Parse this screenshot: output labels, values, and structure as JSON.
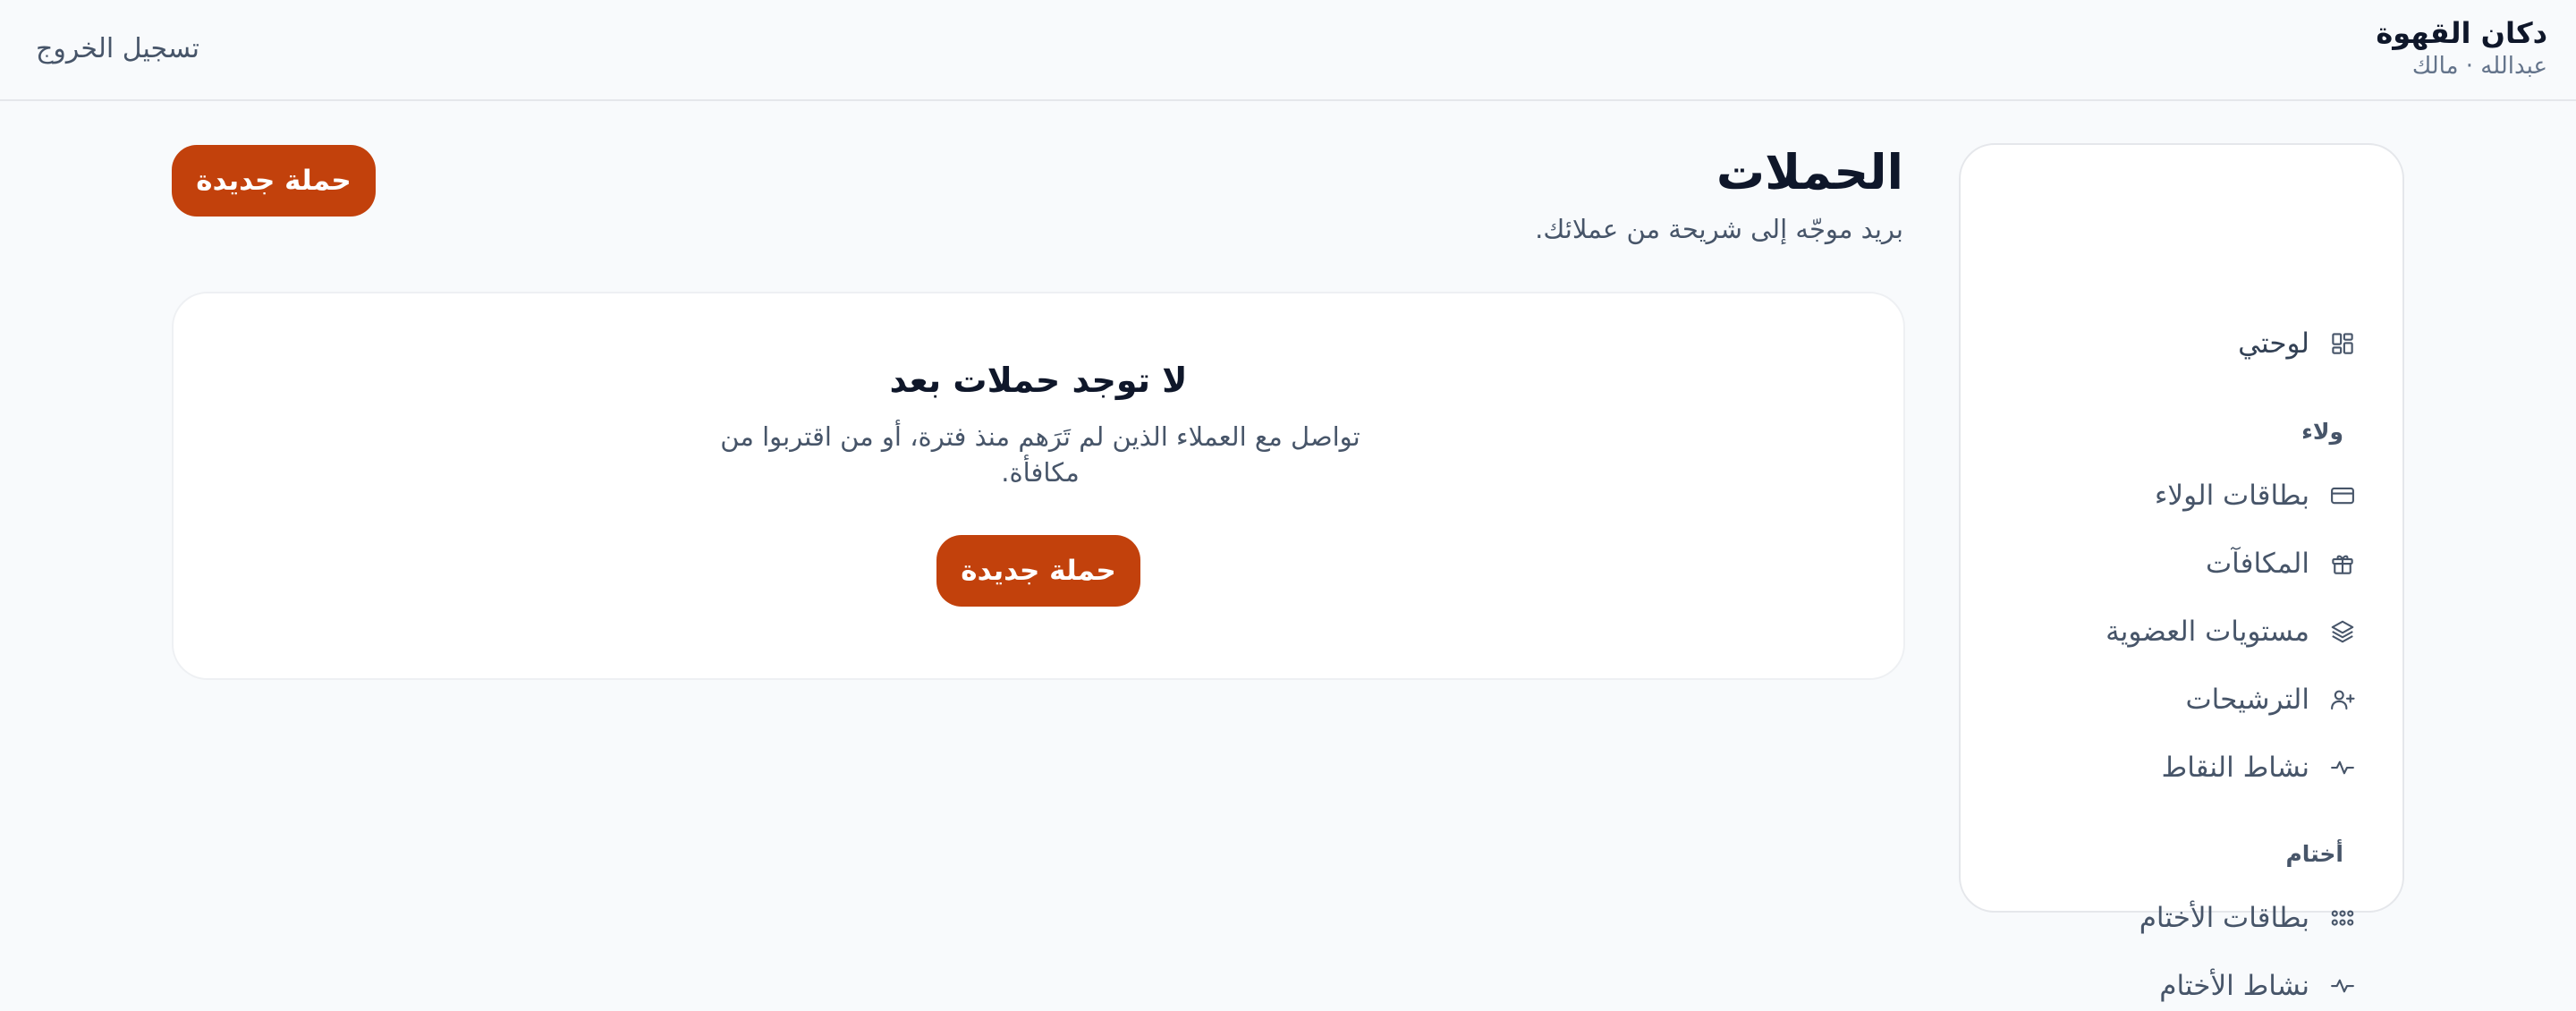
{
  "header": {
    "brand_name": "دكان القهوة",
    "user_line": "عبدالله · مالك",
    "logout_label": "تسجيل الخروج"
  },
  "sidebar": {
    "items": [
      {
        "label": "لوحتي",
        "icon": "dashboard-icon"
      }
    ],
    "sections": [
      {
        "title": "ولاء",
        "items": [
          {
            "label": "بطاقات الولاء",
            "icon": "card-icon"
          },
          {
            "label": "المكافآت",
            "icon": "gift-icon"
          },
          {
            "label": "مستويات العضوية",
            "icon": "layers-icon"
          },
          {
            "label": "الترشيحات",
            "icon": "user-plus-icon"
          },
          {
            "label": "نشاط النقاط",
            "icon": "activity-icon"
          }
        ]
      },
      {
        "title": "أختام",
        "items": [
          {
            "label": "بطاقات الأختام",
            "icon": "stamps-grid-icon"
          },
          {
            "label": "نشاط الأختام",
            "icon": "activity-icon"
          }
        ]
      }
    ]
  },
  "main": {
    "title": "الحملات",
    "subtitle": "بريد موجّه إلى شريحة من عملائك.",
    "new_button_label": "حملة جديدة",
    "empty": {
      "title": "لا توجد حملات بعد",
      "description": "تواصل مع العملاء الذين لم تَرَهم منذ فترة، أو من اقتربوا من مكافأة.",
      "button_label": "حملة جديدة"
    }
  },
  "colors": {
    "accent": "#c2410c",
    "background": "#f8fafc",
    "card": "#ffffff",
    "text": "#0f172a",
    "muted": "#475569"
  }
}
